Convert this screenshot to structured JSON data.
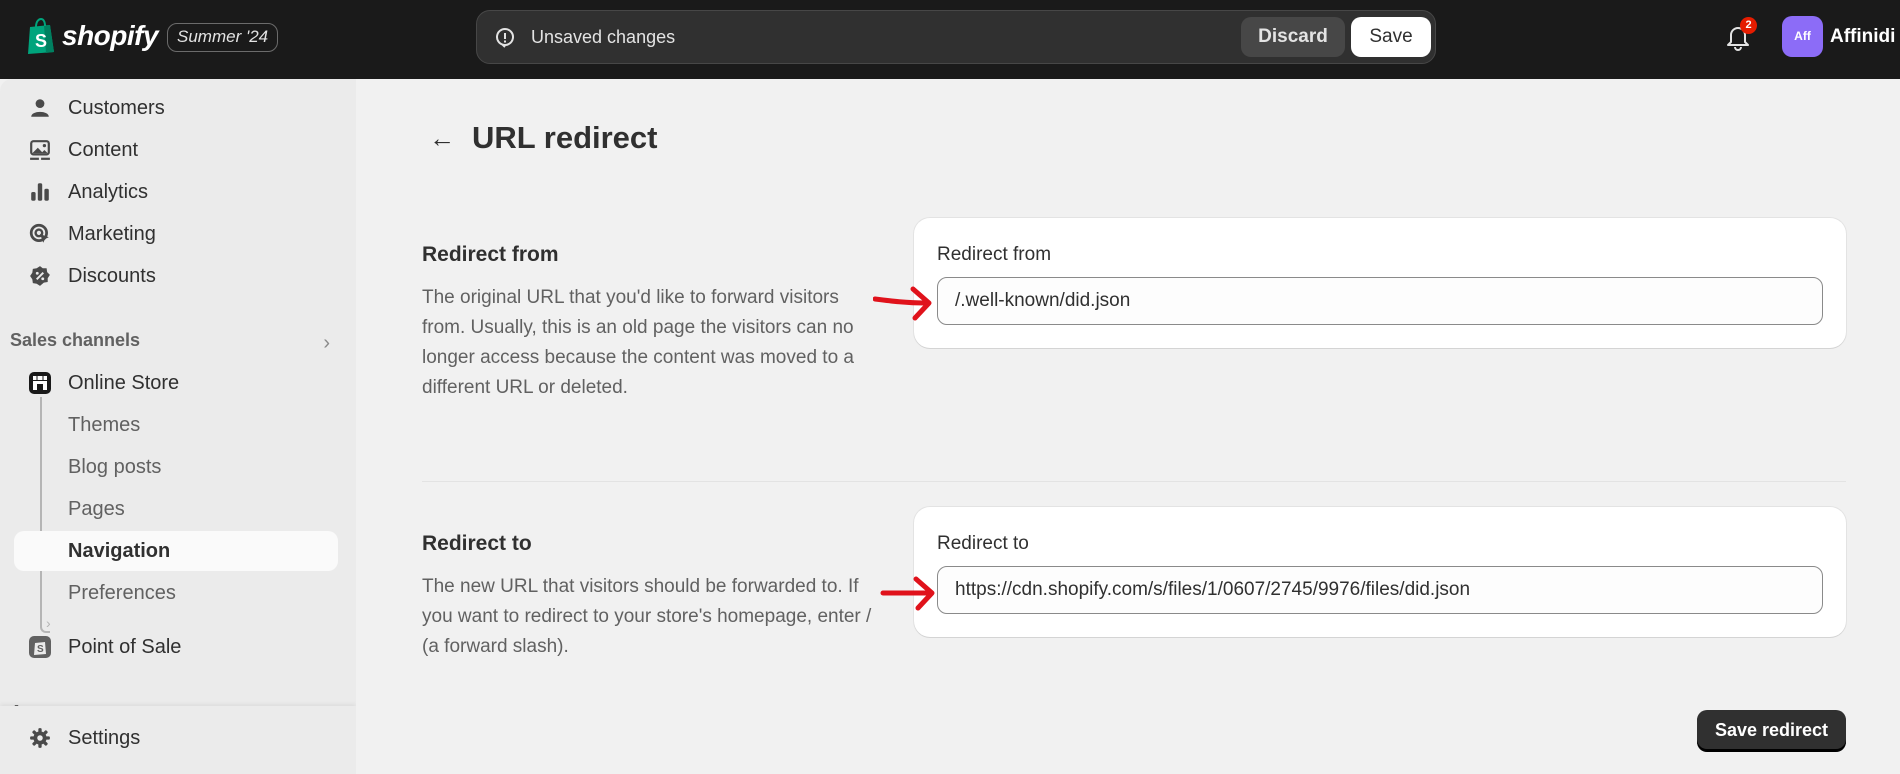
{
  "topbar": {
    "brand": "shopify",
    "edition": "Summer '24",
    "unsaved_text": "Unsaved changes",
    "discard_label": "Discard",
    "save_label": "Save",
    "notification_count": "2",
    "avatar_initials": "Aff",
    "account_name": "Affinidi"
  },
  "sidebar": {
    "items": [
      {
        "label": "Customers",
        "icon": "person-icon"
      },
      {
        "label": "Content",
        "icon": "image-icon"
      },
      {
        "label": "Analytics",
        "icon": "bar-chart-icon"
      },
      {
        "label": "Marketing",
        "icon": "target-icon"
      },
      {
        "label": "Discounts",
        "icon": "discount-icon"
      }
    ],
    "sales_channels_label": "Sales channels",
    "online_store": {
      "label": "Online Store",
      "subitems": [
        "Themes",
        "Blog posts",
        "Pages",
        "Navigation",
        "Preferences"
      ],
      "active": "Navigation"
    },
    "point_of_sale_label": "Point of Sale",
    "apps_label": "Apps",
    "settings_label": "Settings"
  },
  "page": {
    "title": "URL redirect",
    "redirect_from": {
      "section_title": "Redirect from",
      "description": "The original URL that you'd like to forward visitors from. Usually, this is an old page the visitors can no longer access because the content was moved to a different URL or deleted.",
      "field_label": "Redirect from",
      "value": "/.well-known/did.json"
    },
    "redirect_to": {
      "section_title": "Redirect to",
      "description": "The new URL that visitors should be forwarded to. If you want to redirect to your store's homepage, enter / (a forward slash).",
      "field_label": "Redirect to",
      "value": "https://cdn.shopify.com/s/files/1/0607/2745/9976/files/did.json"
    },
    "save_redirect_label": "Save redirect"
  },
  "colors": {
    "topbar_bg": "#1a1a1a",
    "sidebar_bg": "#ebebeb",
    "main_bg": "#f1f1f1",
    "avatar": "#8c6cf7",
    "badge": "#e51c00",
    "annotation": "#e0121b"
  }
}
